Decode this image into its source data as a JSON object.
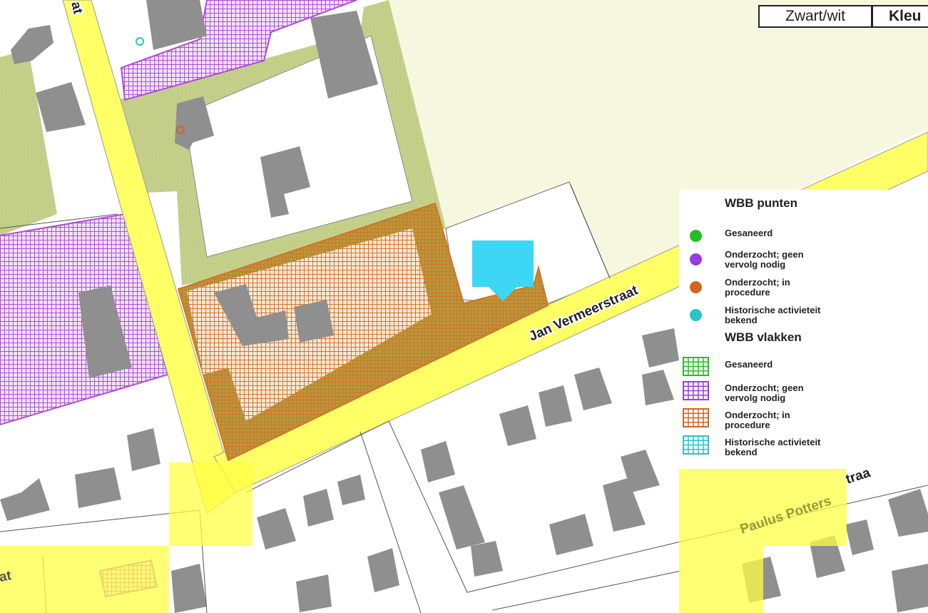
{
  "controls": {
    "bw_label": "Zwart/wit",
    "color_label": "Kleu"
  },
  "streets": {
    "vermeer": "Jan Vermeerstraat",
    "potter_a": "Paulus Potters",
    "potter_b": "traa",
    "side_top": "at",
    "side_bottom": "at"
  },
  "legend": {
    "points_title": "WBB punten",
    "areas_title": "WBB vlakken",
    "points": [
      {
        "line1": "Gesaneerd",
        "line2": "",
        "color": "#22c022"
      },
      {
        "line1": "Onderzocht; geen",
        "line2": "vervolg nodig",
        "color": "#9a3be0"
      },
      {
        "line1": "Onderzocht; in",
        "line2": "procedure",
        "color": "#d5641c"
      },
      {
        "line1": "Historische activieteit",
        "line2": "bekend",
        "color": "#27c4c9"
      }
    ],
    "areas": [
      {
        "line1": "Gesaneerd",
        "line2": "",
        "color": "#22c022"
      },
      {
        "line1": "Onderzocht; geen",
        "line2": "vervolg nodig",
        "color": "#9a3be0"
      },
      {
        "line1": "Onderzocht; in",
        "line2": "procedure",
        "color": "#d5641c"
      },
      {
        "line1": "Historische activieteit",
        "line2": "bekend",
        "color": "#27c4c9"
      }
    ]
  },
  "colors": {
    "background": "#ffffff",
    "road": "#ffff66",
    "green_strip": "#c4d08a",
    "open_area": "#f7f7e0",
    "building": "#8f8f8f",
    "purple_hatch": "#b04ad9",
    "orange_hatch": "#d0742c",
    "marker": "#3dd6f5",
    "highlight": "#ffff44"
  }
}
